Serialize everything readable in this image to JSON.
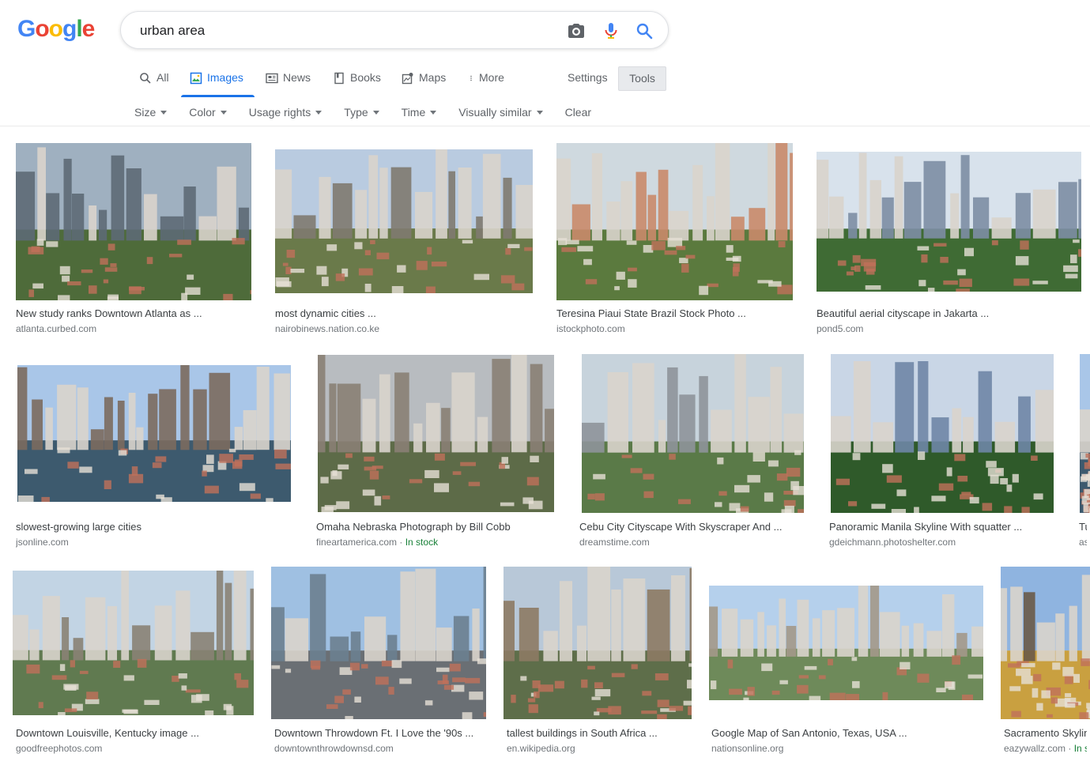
{
  "logo": {
    "text": "Google"
  },
  "search": {
    "query": "urban area"
  },
  "tabs": [
    {
      "label": "All"
    },
    {
      "label": "Images"
    },
    {
      "label": "News"
    },
    {
      "label": "Books"
    },
    {
      "label": "Maps"
    },
    {
      "label": "More"
    }
  ],
  "settings_label": "Settings",
  "tools_label": "Tools",
  "filters": [
    "Size",
    "Color",
    "Usage rights",
    "Type",
    "Time",
    "Visually similar",
    "Clear"
  ],
  "colors": {
    "accent": "#1a73e8",
    "instock": "#188038"
  },
  "results": [
    {
      "caption": "New study ranks Downtown Atlanta as ...",
      "source": "atlanta.curbed.com"
    },
    {
      "caption": "most dynamic cities ...",
      "source": "nairobinews.nation.co.ke"
    },
    {
      "caption": "Teresina Piaui State Brazil Stock Photo ...",
      "source": "istockphoto.com"
    },
    {
      "caption": "Beautiful aerial cityscape in Jakarta ...",
      "source": "pond5.com"
    },
    {
      "caption": "slowest-growing large cities",
      "source": "jsonline.com"
    },
    {
      "caption": "Omaha Nebraska Photograph by Bill Cobb",
      "source": "fineartamerica.com",
      "badge": "In stock"
    },
    {
      "caption": "Cebu City Cityscape With Skyscraper And ...",
      "source": "dreamstime.com"
    },
    {
      "caption": "Panoramic Manila Skyline With squatter ...",
      "source": "gdeichmann.photoshelter.com"
    },
    {
      "caption": "Tu",
      "source": "as"
    },
    {
      "caption": "Downtown Louisville, Kentucky image ...",
      "source": "goodfreephotos.com"
    },
    {
      "caption": "Downtown Throwdown Ft. I Love the '90s ...",
      "source": "downtownthrowdownsd.com"
    },
    {
      "caption": "tallest buildings in South Africa ...",
      "source": "en.wikipedia.org"
    },
    {
      "caption": "Google Map of San Antonio, Texas, USA ...",
      "source": "nationsonline.org"
    },
    {
      "caption": "Sacramento Skylin",
      "source": "eazywallz.com",
      "badge": "In s"
    }
  ]
}
